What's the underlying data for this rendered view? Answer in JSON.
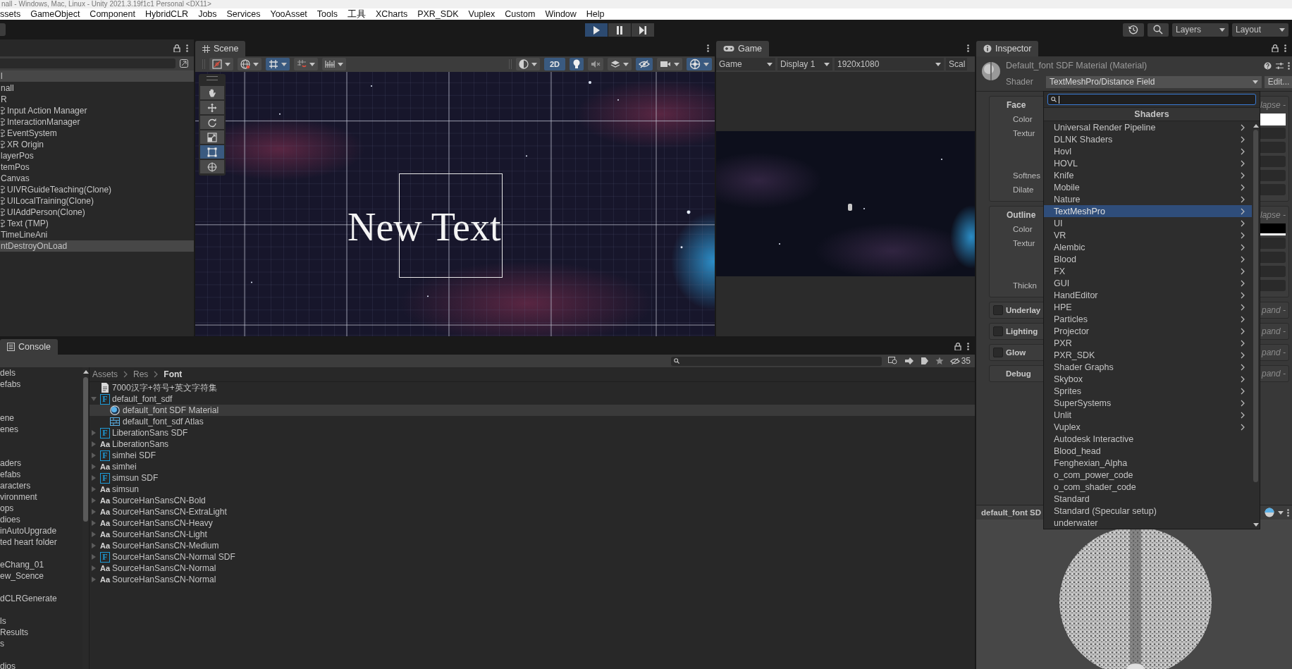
{
  "window": {
    "title": "nall - Windows, Mac, Linux - Unity 2021.3.19f1c1 Personal <DX11>"
  },
  "menu": [
    "ssets",
    "GameObject",
    "Component",
    "HybridCLR",
    "Jobs",
    "Services",
    "YooAsset",
    "Tools",
    "工具",
    "XCharts",
    "PXR_SDK",
    "Vuplex",
    "Custom",
    "Window",
    "Help"
  ],
  "toolbar": {
    "play_buttons": [
      {
        "kind": "play",
        "on": true
      },
      {
        "kind": "pause",
        "on": false
      },
      {
        "kind": "step",
        "on": false
      }
    ],
    "layers": "Layers",
    "layout": "Layout"
  },
  "hierarchy": {
    "items": [
      {
        "label": "l",
        "kind": "scene",
        "children": [
          {
            "label": "nall",
            "kind": "object"
          },
          {
            "label": "R",
            "kind": "object",
            "children": [
              {
                "label": "Input Action Manager",
                "kind": "prefab"
              },
              {
                "label": "InteractionManager",
                "kind": "prefab"
              },
              {
                "label": "EventSystem",
                "kind": "prefab"
              },
              {
                "label": "XR Origin",
                "kind": "prefab"
              }
            ]
          },
          {
            "label": "layerPos",
            "kind": "object"
          },
          {
            "label": "temPos",
            "kind": "object"
          },
          {
            "label": "Canvas",
            "kind": "object",
            "children": [
              {
                "label": "UIVRGuideTeaching(Clone)",
                "kind": "prefab"
              },
              {
                "label": "UILocalTraining(Clone)",
                "kind": "prefab"
              },
              {
                "label": "UIAddPerson(Clone)",
                "kind": "prefab"
              },
              {
                "label": "Text (TMP)",
                "kind": "prefab"
              }
            ]
          },
          {
            "label": "TimeLineAni",
            "kind": "object"
          }
        ]
      },
      {
        "label": "ntDestroyOnLoad",
        "kind": "scene"
      }
    ]
  },
  "scene": {
    "tab": "Scene",
    "text": "New Text",
    "tools": [
      {
        "kind": "hand",
        "selected": false
      },
      {
        "kind": "move",
        "selected": false
      },
      {
        "kind": "rotate",
        "selected": false
      },
      {
        "kind": "scale",
        "selected": false
      },
      {
        "kind": "rect",
        "selected": true
      },
      {
        "kind": "transform",
        "selected": false
      }
    ],
    "left_buttons": [
      {
        "kind": "draw-mode",
        "on": false,
        "caret": true
      },
      {
        "kind": "globe",
        "on": false,
        "caret": true
      },
      {
        "kind": "grid",
        "on": true,
        "caret": true
      },
      {
        "kind": "snap",
        "on": false,
        "caret": true
      },
      {
        "kind": "increment",
        "on": false,
        "caret": true
      }
    ],
    "right_buttons": [
      {
        "kind": "shading",
        "on": false,
        "caret": true
      },
      {
        "kind": "label",
        "label": "2D",
        "on": true,
        "caret": false
      },
      {
        "kind": "lighting",
        "on": true,
        "caret": false
      },
      {
        "kind": "audio",
        "on": false,
        "caret": false
      },
      {
        "kind": "effects",
        "on": false,
        "caret": true
      },
      {
        "kind": "visibility",
        "on": true,
        "caret": false
      },
      {
        "kind": "camera",
        "on": false,
        "caret": true
      },
      {
        "kind": "gizmos",
        "on": true,
        "caret": true
      }
    ]
  },
  "game": {
    "tab": "Game",
    "dropdowns": [
      {
        "label": "Game"
      },
      {
        "label": "Display 1"
      },
      {
        "label": "1920x1080"
      },
      {
        "label": "Scal"
      }
    ]
  },
  "inspector": {
    "tab": "Inspector",
    "title": "Default_font SDF Material (Material)",
    "shader_label": "Shader",
    "shader": "TextMeshPro/Distance Field",
    "edit": "Edit...",
    "sections": [
      {
        "title": "Face",
        "kind": "expanded",
        "toggle_text": "lapse -",
        "fields": [
          {
            "label": "Color",
            "kind": "color",
            "color": "#ffffff"
          },
          {
            "label": "Textur",
            "kind": "texture"
          },
          {
            "label": "Softnes",
            "kind": "number"
          },
          {
            "label": "Dilate",
            "kind": "number"
          }
        ]
      },
      {
        "title": "Outline",
        "kind": "expanded",
        "toggle_text": "lapse -",
        "fields": [
          {
            "label": "Color",
            "kind": "color",
            "color": "#000000"
          },
          {
            "label": "Textur",
            "kind": "texture"
          },
          {
            "label": "Thickn",
            "kind": "number"
          }
        ]
      },
      {
        "title": "Underlay",
        "kind": "collapsed",
        "checked": false,
        "toggle_text": "pand -"
      },
      {
        "title": "Lighting",
        "kind": "collapsed",
        "checked": false,
        "toggle_text": "pand -"
      },
      {
        "title": "Glow",
        "kind": "collapsed",
        "checked": false,
        "toggle_text": "pand -"
      },
      {
        "title": "Debug",
        "kind": "collapsed",
        "toggle_text": "pand -"
      }
    ],
    "preview_title": "default_font SD",
    "shader_menu": {
      "header": "Shaders",
      "items": [
        {
          "label": "Universal Render Pipeline",
          "submenu": true,
          "selected": false
        },
        {
          "label": "DLNK Shaders",
          "submenu": true,
          "selected": false
        },
        {
          "label": "Hovl",
          "submenu": true,
          "selected": false
        },
        {
          "label": "HOVL",
          "submenu": true,
          "selected": false
        },
        {
          "label": "Knife",
          "submenu": true,
          "selected": false
        },
        {
          "label": "Mobile",
          "submenu": true,
          "selected": false
        },
        {
          "label": "Nature",
          "submenu": true,
          "selected": false
        },
        {
          "label": "TextMeshPro",
          "submenu": true,
          "selected": true
        },
        {
          "label": "UI",
          "submenu": true,
          "selected": false
        },
        {
          "label": "VR",
          "submenu": true,
          "selected": false
        },
        {
          "label": "Alembic",
          "submenu": true,
          "selected": false
        },
        {
          "label": "Blood",
          "submenu": true,
          "selected": false
        },
        {
          "label": "FX",
          "submenu": true,
          "selected": false
        },
        {
          "label": "GUI",
          "submenu": true,
          "selected": false
        },
        {
          "label": "HandEditor",
          "submenu": true,
          "selected": false
        },
        {
          "label": "HPE",
          "submenu": true,
          "selected": false
        },
        {
          "label": "Particles",
          "submenu": true,
          "selected": false
        },
        {
          "label": "Projector",
          "submenu": true,
          "selected": false
        },
        {
          "label": "PXR",
          "submenu": true,
          "selected": false
        },
        {
          "label": "PXR_SDK",
          "submenu": true,
          "selected": false
        },
        {
          "label": "Shader Graphs",
          "submenu": true,
          "selected": false
        },
        {
          "label": "Skybox",
          "submenu": true,
          "selected": false
        },
        {
          "label": "Sprites",
          "submenu": true,
          "selected": false
        },
        {
          "label": "SuperSystems",
          "submenu": true,
          "selected": false
        },
        {
          "label": "Unlit",
          "submenu": true,
          "selected": false
        },
        {
          "label": "Vuplex",
          "submenu": true,
          "selected": false
        },
        {
          "label": "Autodesk Interactive",
          "submenu": false,
          "selected": false
        },
        {
          "label": "Blood_head",
          "submenu": false,
          "selected": false
        },
        {
          "label": "Fenghexian_Alpha",
          "submenu": false,
          "selected": false
        },
        {
          "label": "o_com_power_code",
          "submenu": false,
          "selected": false
        },
        {
          "label": "o_com_shader_code",
          "submenu": false,
          "selected": false
        },
        {
          "label": "Standard",
          "submenu": false,
          "selected": false
        },
        {
          "label": "Standard (Specular setup)",
          "submenu": false,
          "selected": false
        },
        {
          "label": "underwater",
          "submenu": false,
          "selected": false
        }
      ]
    }
  },
  "project": {
    "tab": "Console",
    "count": "35",
    "breadcrumb": [
      "Assets",
      "Res",
      "Font"
    ],
    "folders": [
      {
        "kind": "folder",
        "label": "dels"
      },
      {
        "kind": "folder",
        "label": "efabs"
      },
      {
        "kind": "blank"
      },
      {
        "kind": "blank"
      },
      {
        "kind": "folder",
        "label": "ene"
      },
      {
        "kind": "folder",
        "label": "enes"
      },
      {
        "kind": "blank"
      },
      {
        "kind": "blank"
      },
      {
        "kind": "folder",
        "label": "aders"
      },
      {
        "kind": "folder",
        "label": "efabs"
      },
      {
        "kind": "folder",
        "label": "aracters"
      },
      {
        "kind": "folder",
        "label": "vironment"
      },
      {
        "kind": "folder",
        "label": "ops"
      },
      {
        "kind": "folder",
        "label": "dioes"
      },
      {
        "kind": "folder",
        "label": "inAutoUpgrade"
      },
      {
        "kind": "folder",
        "label": "ted heart folder"
      },
      {
        "kind": "blank"
      },
      {
        "kind": "folder",
        "label": "eChang_01"
      },
      {
        "kind": "folder",
        "label": "ew_Scence"
      },
      {
        "kind": "blank"
      },
      {
        "kind": "folder",
        "label": "dCLRGenerate"
      },
      {
        "kind": "blank"
      },
      {
        "kind": "folder",
        "label": "ls"
      },
      {
        "kind": "folder",
        "label": "Results"
      },
      {
        "kind": "folder",
        "label": "s"
      },
      {
        "kind": "blank"
      },
      {
        "kind": "folder",
        "label": "dios"
      }
    ],
    "assets": [
      {
        "label": "7000汉字+符号+英文字符集",
        "kind": "text",
        "selected": false
      },
      {
        "label": "default_font_sdf",
        "kind": "font_asset",
        "icon_text": "F",
        "expanded": true,
        "selected": false,
        "children": [
          {
            "label": "default_font SDF Material",
            "kind": "material",
            "selected": true
          },
          {
            "label": "default_font_sdf Atlas",
            "kind": "atlas",
            "selected": false
          }
        ]
      },
      {
        "label": "LiberationSans SDF",
        "kind": "font_asset",
        "icon_text": "F",
        "expanded": false,
        "selected": false
      },
      {
        "label": "LiberationSans",
        "kind": "font",
        "icon_text": "Aa",
        "expanded": false,
        "selected": false
      },
      {
        "label": "simhei SDF",
        "kind": "font_asset",
        "icon_text": "F",
        "expanded": false,
        "selected": false
      },
      {
        "label": "simhei",
        "kind": "font",
        "icon_text": "Aa",
        "expanded": false,
        "selected": false
      },
      {
        "label": "simsun SDF",
        "kind": "font_asset",
        "icon_text": "F",
        "expanded": false,
        "selected": false
      },
      {
        "label": "simsun",
        "kind": "font",
        "icon_text": "Aa",
        "expanded": false,
        "selected": false
      },
      {
        "label": "SourceHanSansCN-Bold",
        "kind": "font",
        "icon_text": "Aa",
        "expanded": false,
        "selected": false
      },
      {
        "label": "SourceHanSansCN-ExtraLight",
        "kind": "font",
        "icon_text": "Aa",
        "expanded": false,
        "selected": false
      },
      {
        "label": "SourceHanSansCN-Heavy",
        "kind": "font",
        "icon_text": "Aa",
        "expanded": false,
        "selected": false
      },
      {
        "label": "SourceHanSansCN-Light",
        "kind": "font",
        "icon_text": "Aa",
        "expanded": false,
        "selected": false
      },
      {
        "label": "SourceHanSansCN-Medium",
        "kind": "font",
        "icon_text": "Aa",
        "expanded": false,
        "selected": false
      },
      {
        "label": "SourceHanSansCN-Normal SDF",
        "kind": "font_asset",
        "icon_text": "F",
        "expanded": false,
        "selected": false
      },
      {
        "label": "SourceHanSansCN-Normal",
        "kind": "font",
        "icon_text": "Aa",
        "expanded": false,
        "selected": false
      },
      {
        "label": "SourceHanSansCN-Normal",
        "kind": "font",
        "icon_text": "Aa",
        "expanded": false,
        "selected": false
      }
    ]
  }
}
